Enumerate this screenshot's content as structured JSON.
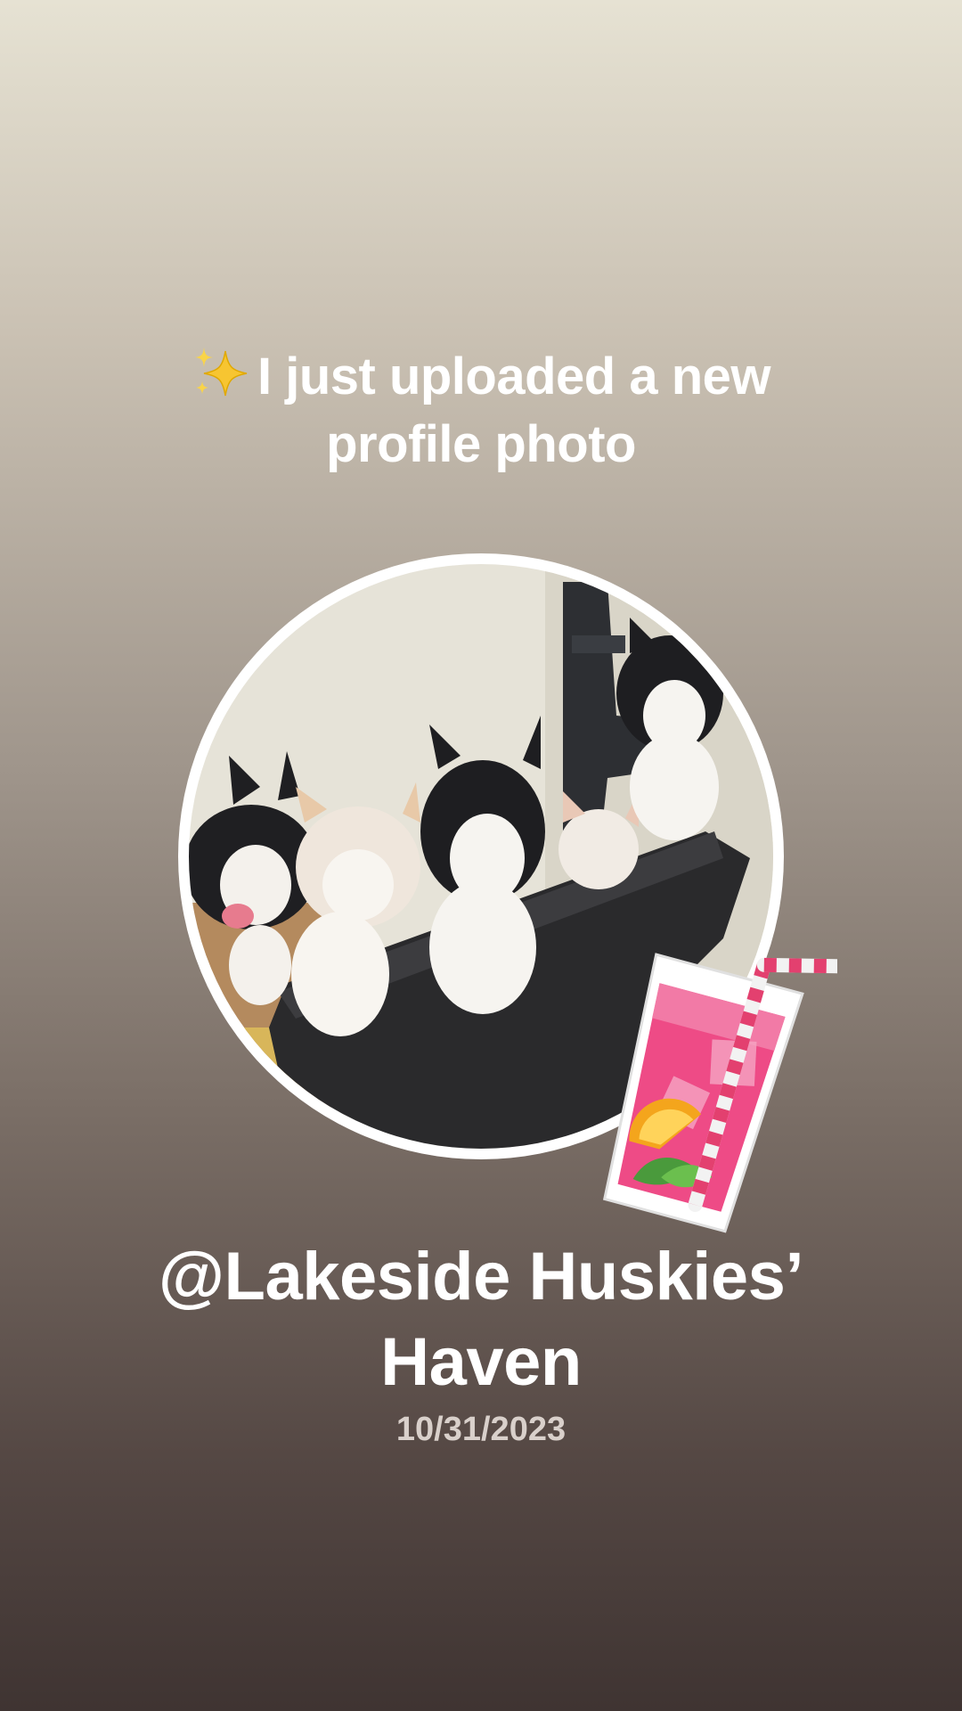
{
  "story": {
    "headline": "I just uploaded a new profile photo",
    "headline_emoji": "sparkles-icon",
    "handle": "@Lakeside Huskies’ Haven",
    "date": "10/31/2023"
  },
  "profile_photo": {
    "subject": "husky-puppies-photo"
  },
  "sticker": {
    "icon": "pink-drink-icon"
  },
  "colors": {
    "text": "#ffffff",
    "date_text": "#d9d0cb",
    "gradient_top": "#e6e2d3",
    "gradient_bottom": "#3f3432",
    "sticker_pink": "#ee4b86"
  }
}
